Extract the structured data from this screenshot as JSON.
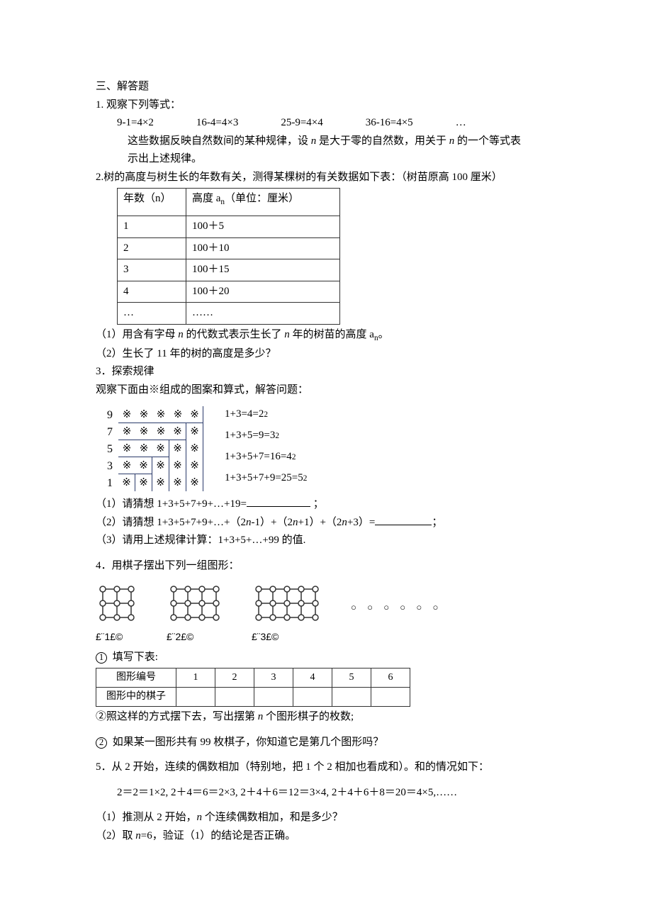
{
  "header": "三、解答题",
  "q1": {
    "title": "1. 观察下列等式：",
    "eqs": [
      "9-1=4×2",
      "16-4=4×3",
      "25-9=4×4",
      "36-16=4×5",
      "…"
    ],
    "desc": "这些数据反映自然数间的某种规律，设 n 是大于零的自然数，用关于 n 的一个等式表示出上述规律。"
  },
  "q2": {
    "title": "2.树的高度与树生长的年数有关，测得某棵树的有关数据如下表：（树苗原高 100 厘米）",
    "th1": "年数（n）",
    "th2": "高度 aₙ（单位：厘米）",
    "rows": [
      {
        "n": "1",
        "h": "100＋5"
      },
      {
        "n": "2",
        "h": "100＋10"
      },
      {
        "n": "3",
        "h": "100＋15"
      },
      {
        "n": "4",
        "h": "100＋20"
      },
      {
        "n": "…",
        "h": "……"
      }
    ],
    "sub1_a": "（1）用含有字母 ",
    "sub1_b": " 的代数式表示生长了 ",
    "sub1_c": " 年的树苗的高度 a",
    "sub1_d": "。",
    "sub2": "（2）生长了 11 年的树的高度是多少？"
  },
  "q3": {
    "title": "3．探索规律",
    "subtitle": "观察下面由※组成的图案和算式，解答问题：",
    "row_nums": [
      "9",
      "7",
      "5",
      "3",
      "1"
    ],
    "star": "※",
    "eqs": [
      "1+3=4=2²",
      "1+3+5=9=3²",
      "1+3+5+7=16=4²",
      "1+3+5+7+9=25=5²"
    ],
    "p1": "（1）请猜想 1+3+5+7+9+…+19=",
    "p1_tail": " ；",
    "p2a": "（2）请猜想 1+3+5+7+9+…+（2",
    "p2b": "-1）+（2",
    "p2c": "+1）+（2",
    "p2d": "+3）=",
    "p2_tail": "；",
    "p3": "（3）请用上述规律计算：1+3+5+…+99 的值."
  },
  "q4": {
    "title": "4．用棋子摆出下列一组图形：",
    "labels": [
      "£¨1£©",
      "£¨2£©",
      "£¨3£©"
    ],
    "dots": "○ ○ ○ ○ ○ ○",
    "fill_title": " 填写下表:",
    "t_h1": "图形编号",
    "t_h2": "图形中的棋子",
    "cols": [
      "1",
      "2",
      "3",
      "4",
      "5",
      "6"
    ],
    "p2": "②照这样的方式摆下去，写出摆第 n 个图形棋子的枚数;",
    "p3_a": " 如果某一图形共有 99 枚棋子，你知道它是第几个图形吗？"
  },
  "q5": {
    "title": "5．从 2 开始，连续的偶数相加（特别地，把 1 个 2 相加也看成和）。和的情况如下：",
    "eq": "2＝2＝1×2, 2＋4＝6＝2×3, 2＋4＋6＝12＝3×4, 2＋4＋6＋8＝20＝4×5,……",
    "p1_a": "（1）推测从 2 开始，",
    "p1_b": " 个连续偶数相加，和是多少？",
    "p2_a": "（2）取 ",
    "p2_b": "=6，验证（1）的结论是否正确。"
  },
  "sym": {
    "n": "n"
  }
}
